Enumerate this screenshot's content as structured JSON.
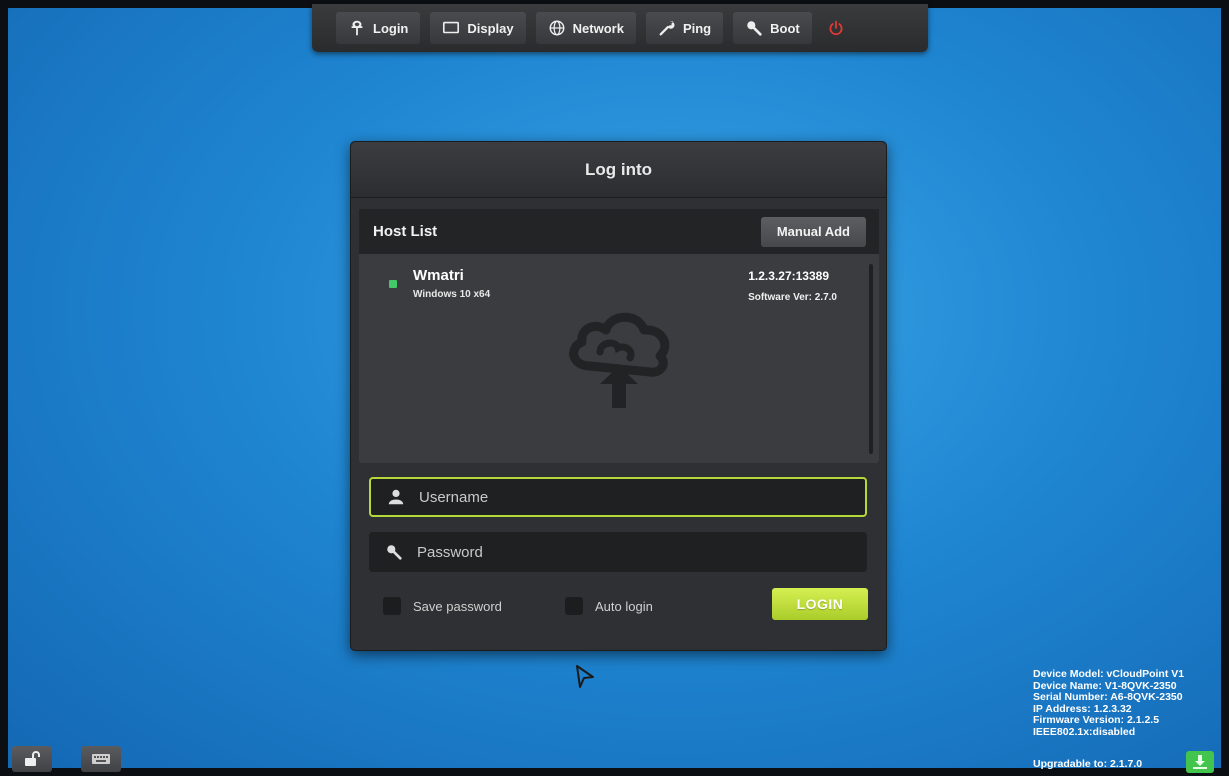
{
  "toolbar": {
    "items": [
      {
        "label": "Login",
        "icon": "login-icon"
      },
      {
        "label": "Display",
        "icon": "display-icon"
      },
      {
        "label": "Network",
        "icon": "globe-icon"
      },
      {
        "label": "Ping",
        "icon": "wrench-icon"
      },
      {
        "label": "Boot",
        "icon": "key-icon"
      }
    ],
    "power_icon": "power-icon",
    "power_color": "#e53935"
  },
  "dialog": {
    "title": "Log into",
    "host_list": {
      "title": "Host List",
      "manual_add_label": "Manual Add",
      "hosts": [
        {
          "name": "Wmatri",
          "os": "Windows 10 x64",
          "address": "1.2.3.27:13389",
          "software_version": "Software Ver: 2.7.0",
          "status_color": "#43c86a"
        }
      ],
      "empty_icon": "cloud-upload-icon"
    },
    "username": {
      "placeholder": "Username",
      "value": ""
    },
    "password": {
      "placeholder": "Password",
      "value": ""
    },
    "save_password_label": "Save password",
    "auto_login_label": "Auto login",
    "login_label": "LOGIN"
  },
  "device_info": {
    "model": "Device Model: vCloudPoint V1",
    "name": "Device Name: V1-8QVK-2350",
    "serial": "Serial Number: A6-8QVK-2350",
    "ip": "IP Address: 1.2.3.32",
    "firmware": "Firmware Version: 2.1.2.5",
    "ieee": "IEEE802.1x:disabled",
    "upgradable": "Upgradable to: 2.1.7.0"
  },
  "colors": {
    "accent": "#b6d93a",
    "background": "#1f86d2",
    "upgrade": "#43c44d"
  }
}
